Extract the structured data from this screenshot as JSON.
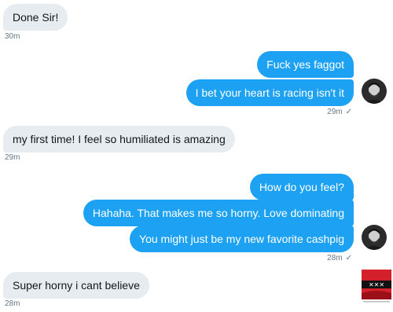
{
  "messages": [
    {
      "direction": "in",
      "text": "Done Sir!"
    },
    {
      "direction": "out",
      "text": "Fuck yes faggot"
    },
    {
      "direction": "out",
      "text": "I bet your heart is racing isn't it"
    },
    {
      "direction": "in",
      "text": "my first time! I feel so humiliated is amazing"
    },
    {
      "direction": "out",
      "text": "How do you feel?"
    },
    {
      "direction": "out",
      "text": "Hahaha. That makes me so horny. Love dominating"
    },
    {
      "direction": "out",
      "text": "You might just be my new favorite cashpig"
    },
    {
      "direction": "in",
      "text": "Super horny i cant believe"
    }
  ],
  "timestamps": {
    "t1": "30m",
    "t2": "29m",
    "t3": "29m",
    "t4": "28m",
    "t5": "28m"
  },
  "read_receipt_icon": "checkmark-icon",
  "colors": {
    "outgoing_bubble": "#1da1f2",
    "incoming_bubble": "#e6ecf0",
    "timestamp": "#657786",
    "background": "#ffffff"
  }
}
